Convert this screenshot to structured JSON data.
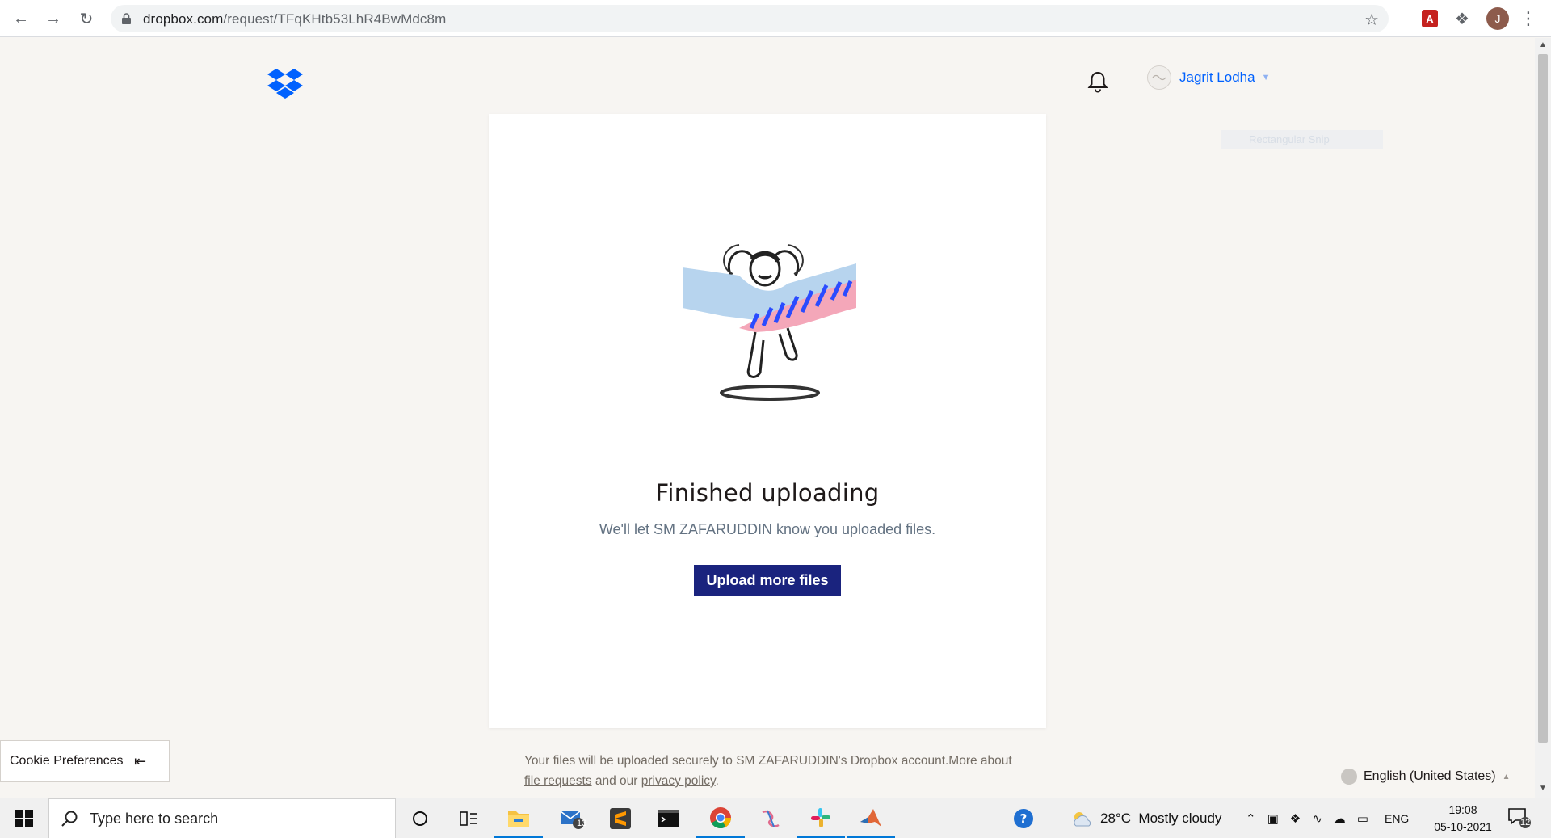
{
  "browser": {
    "url_host": "dropbox.com",
    "url_path": "/request/TFqKHtb53LhR4BwMdc8m",
    "profile_initial": "J",
    "pdf_ext_label": "A"
  },
  "header": {
    "user_name": "Jagrit Lodha"
  },
  "ghost_overlay": "Rectangular Snip",
  "card": {
    "title": "Finished uploading",
    "subtitle": "We'll let SM ZAFARUDDIN know you uploaded files.",
    "button_label": "Upload more files"
  },
  "footer": {
    "note_prefix": "Your files will be uploaded securely to SM ZAFARUDDIN's Dropbox account.More about ",
    "link_file_requests": "file requests",
    "note_mid": " and our ",
    "link_privacy": "privacy policy",
    "note_end": "."
  },
  "cookie": {
    "label": "Cookie Preferences"
  },
  "language": {
    "label": "English (United States)"
  },
  "taskbar": {
    "search_placeholder": "Type here to search",
    "mail_badge": "13",
    "weather": "28°C  Mostly cloudy",
    "lang": "ENG",
    "time": "19:08",
    "date": "05-10-2021",
    "notif_count": "12"
  },
  "colors": {
    "dropbox_blue": "#0061fe",
    "button_navy": "#1a237e",
    "page_bg": "#f7f5f2"
  }
}
